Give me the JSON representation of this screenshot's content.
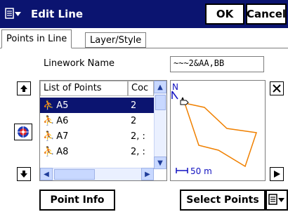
{
  "titlebar": {
    "title": "Edit Line",
    "ok_label": "OK",
    "cancel_label": "Cancel"
  },
  "tabs": [
    {
      "label": "Points in Line"
    },
    {
      "label": "Layer/Style"
    }
  ],
  "form": {
    "linework_label": "Linework Name",
    "linework_value": "~~~2&AA,BB"
  },
  "list": {
    "headers": [
      "List of Points",
      "Coc"
    ],
    "rows": [
      {
        "name": "A5",
        "code": "2",
        "selected": true
      },
      {
        "name": "A6",
        "code": "2"
      },
      {
        "name": "A7",
        "code": "2, :"
      },
      {
        "name": "A8",
        "code": "2, :"
      }
    ]
  },
  "map": {
    "north_label": "N",
    "scale_label": "50 m",
    "line_color": "#f08000"
  },
  "buttons": {
    "point_info": "Point Info",
    "select_points": "Select Points"
  },
  "colors": {
    "titlebar": "#0b1470",
    "selection": "#0b1470"
  }
}
